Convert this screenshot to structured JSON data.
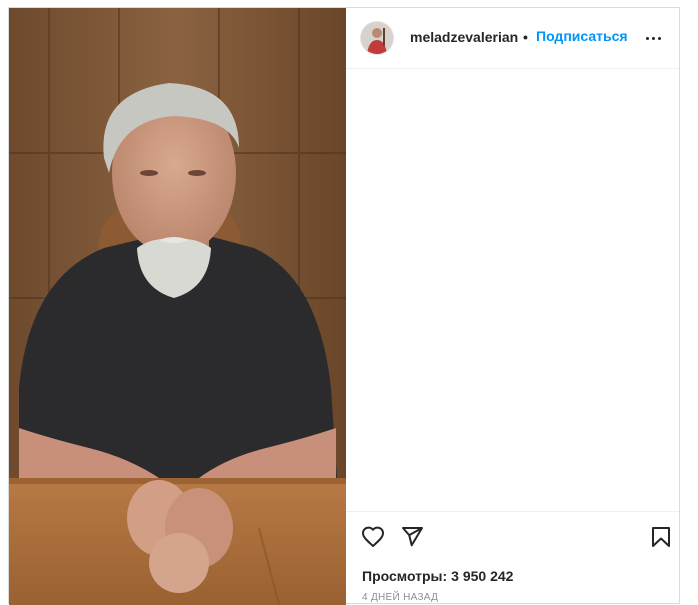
{
  "post": {
    "username": "meladzevalerian",
    "separator": "•",
    "follow_label": "Подписаться",
    "views_label": "Просмотры:",
    "views_count": "3 950 242",
    "date": "4 ДНЕЙ НАЗАД"
  },
  "icons": {
    "more": "more-options-icon",
    "like": "heart-icon",
    "share": "paper-plane-icon",
    "save": "bookmark-icon"
  },
  "colors": {
    "accent": "#0095f6",
    "text": "#262626",
    "muted": "#8e8e8e",
    "border": "#dbdbdb"
  }
}
